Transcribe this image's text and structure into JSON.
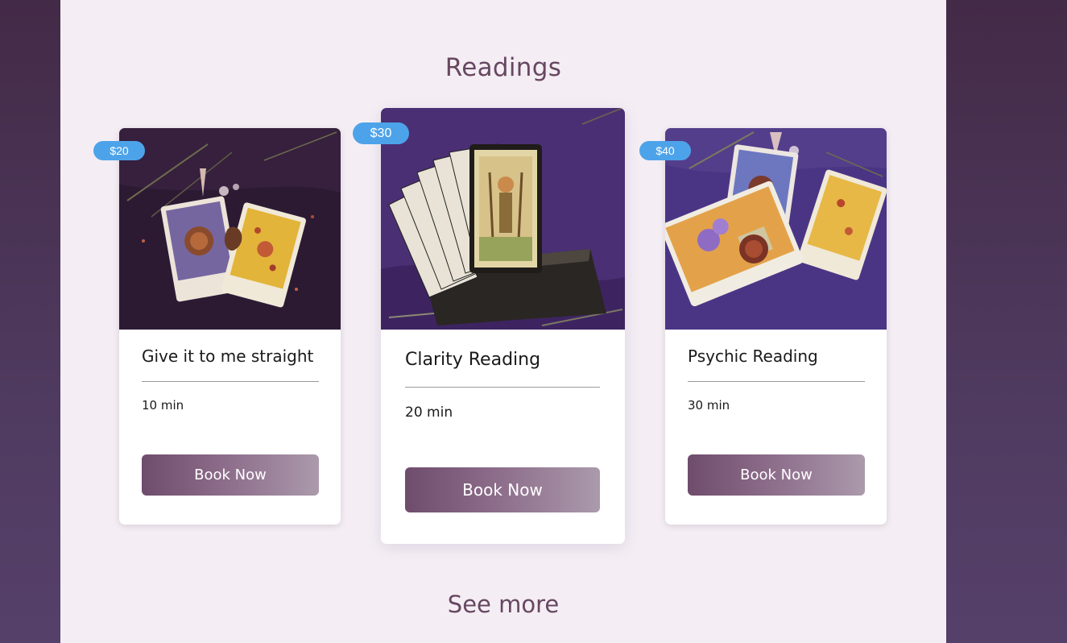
{
  "section": {
    "title": "Readings",
    "see_more_label": "See more"
  },
  "readings": [
    {
      "price": "$20",
      "title": "Give it to me straight",
      "duration": "10 min",
      "button_label": "Book Now",
      "image": "two-tarot-cards-photo"
    },
    {
      "price": "$30",
      "title": "Clarity Reading",
      "duration": "20 min",
      "button_label": "Book Now",
      "image": "tarot-deck-in-wooden-box-photo"
    },
    {
      "price": "$40",
      "title": "Psychic Reading",
      "duration": "30 min",
      "button_label": "Book Now",
      "image": "three-tarot-cards-photo"
    }
  ],
  "colors": {
    "badge": "#4da3e9",
    "accent": "#674761",
    "panel_background": "#f4eef4",
    "page_background": "#4a3352"
  }
}
